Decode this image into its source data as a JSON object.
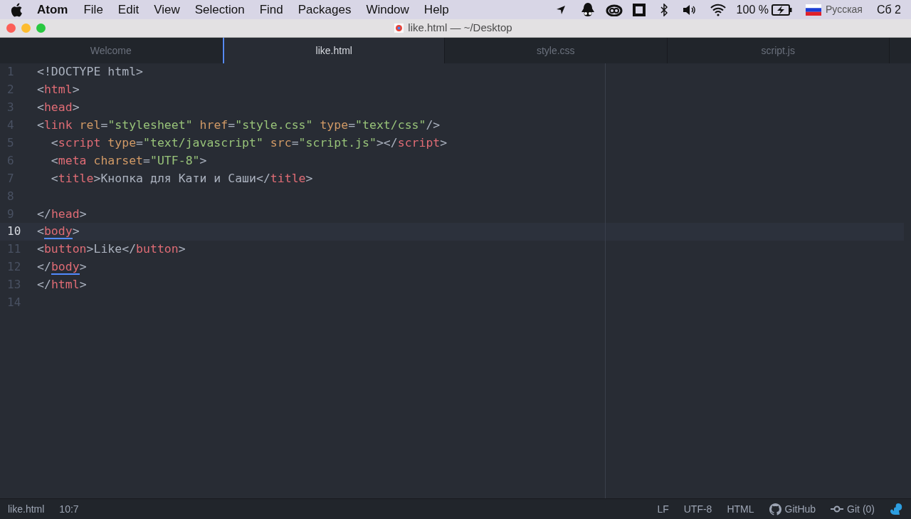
{
  "menu_bar": {
    "app_name": "Atom",
    "menus": [
      "File",
      "Edit",
      "View",
      "Selection",
      "Find",
      "Packages",
      "Window",
      "Help"
    ],
    "battery": "100 %",
    "input_language": "Русская",
    "clock": "Сб 2"
  },
  "window": {
    "title": "like.html — ~/Desktop"
  },
  "tabs": [
    {
      "label": "Welcome",
      "selected": false
    },
    {
      "label": "like.html",
      "selected": true
    },
    {
      "label": "style.css",
      "selected": false
    },
    {
      "label": "script.js",
      "selected": false
    }
  ],
  "editor": {
    "lines": [
      {
        "number": "1",
        "selected": false,
        "tokens": [
          {
            "kind": "punct",
            "text": "<!DOCTYPE html>"
          }
        ]
      },
      {
        "number": "2",
        "selected": false,
        "tokens": [
          {
            "kind": "punct",
            "text": "<"
          },
          {
            "kind": "tag",
            "text": "html"
          },
          {
            "kind": "punct",
            "text": ">"
          }
        ]
      },
      {
        "number": "3",
        "selected": false,
        "tokens": [
          {
            "kind": "punct",
            "text": "<"
          },
          {
            "kind": "tag",
            "text": "head"
          },
          {
            "kind": "punct",
            "text": ">"
          }
        ]
      },
      {
        "number": "4",
        "selected": false,
        "tokens": [
          {
            "kind": "punct",
            "text": "<"
          },
          {
            "kind": "tag",
            "text": "link"
          },
          {
            "kind": "attr",
            "text": " rel"
          },
          {
            "kind": "punct",
            "text": "="
          },
          {
            "kind": "string",
            "text": "\"stylesheet\""
          },
          {
            "kind": "attr",
            "text": " href"
          },
          {
            "kind": "punct",
            "text": "="
          },
          {
            "kind": "string",
            "text": "\"style.css\""
          },
          {
            "kind": "attr",
            "text": " type"
          },
          {
            "kind": "punct",
            "text": "="
          },
          {
            "kind": "string",
            "text": "\"text/css\""
          },
          {
            "kind": "punct",
            "text": "/>"
          }
        ]
      },
      {
        "number": "5",
        "selected": false,
        "tokens": [
          {
            "kind": "punct",
            "text": "  <"
          },
          {
            "kind": "tag",
            "text": "script"
          },
          {
            "kind": "attr",
            "text": " type"
          },
          {
            "kind": "punct",
            "text": "="
          },
          {
            "kind": "string",
            "text": "\"text/javascript\""
          },
          {
            "kind": "attr",
            "text": " src"
          },
          {
            "kind": "punct",
            "text": "="
          },
          {
            "kind": "string",
            "text": "\"script.js\""
          },
          {
            "kind": "punct",
            "text": "></"
          },
          {
            "kind": "tag",
            "text": "script"
          },
          {
            "kind": "punct",
            "text": ">"
          }
        ]
      },
      {
        "number": "6",
        "selected": false,
        "tokens": [
          {
            "kind": "punct",
            "text": "  <"
          },
          {
            "kind": "tag",
            "text": "meta"
          },
          {
            "kind": "attr",
            "text": " charset"
          },
          {
            "kind": "punct",
            "text": "="
          },
          {
            "kind": "string",
            "text": "\"UTF-8\""
          },
          {
            "kind": "punct",
            "text": ">"
          }
        ]
      },
      {
        "number": "7",
        "selected": false,
        "tokens": [
          {
            "kind": "punct",
            "text": "  <"
          },
          {
            "kind": "tag",
            "text": "title"
          },
          {
            "kind": "punct",
            "text": ">Кнопка для Кати и Саши</"
          },
          {
            "kind": "tag",
            "text": "title"
          },
          {
            "kind": "punct",
            "text": ">"
          }
        ]
      },
      {
        "number": "8",
        "selected": false
      },
      {
        "number": "9",
        "selected": false,
        "tokens": [
          {
            "kind": "punct",
            "text": "</"
          },
          {
            "kind": "tag",
            "text": "head"
          },
          {
            "kind": "punct",
            "text": ">"
          }
        ]
      },
      {
        "number": "10",
        "selected": true,
        "tokens": [
          {
            "kind": "punct",
            "text": "<"
          },
          {
            "kind": "matched_tag",
            "text": "body"
          },
          {
            "kind": "punct",
            "text": ">"
          }
        ]
      },
      {
        "number": "11",
        "selected": false,
        "tokens": [
          {
            "kind": "punct",
            "text": "<"
          },
          {
            "kind": "tag",
            "text": "button"
          },
          {
            "kind": "punct",
            "text": ">Like</"
          },
          {
            "kind": "tag",
            "text": "button"
          },
          {
            "kind": "punct",
            "text": ">"
          }
        ]
      },
      {
        "number": "12",
        "selected": false,
        "tokens": [
          {
            "kind": "punct",
            "text": "</"
          },
          {
            "kind": "matched_tag",
            "text": "body"
          },
          {
            "kind": "punct",
            "text": ">"
          }
        ]
      },
      {
        "number": "13",
        "selected": false,
        "tokens": [
          {
            "kind": "punct",
            "text": "</"
          },
          {
            "kind": "tag",
            "text": "html"
          },
          {
            "kind": "punct",
            "text": ">"
          }
        ]
      },
      {
        "number": "14",
        "selected": false
      }
    ]
  },
  "status_bar": {
    "file": "like.html",
    "cursor": "10:7",
    "line_ending": "LF",
    "encoding": "UTF-8",
    "grammar": "HTML",
    "github": "GitHub",
    "git": "Git (0)"
  }
}
